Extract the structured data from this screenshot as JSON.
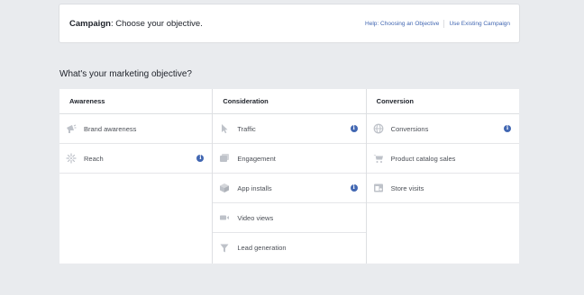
{
  "header": {
    "title_bold": "Campaign",
    "title_rest": ": Choose your objective.",
    "help_link": "Help: Choosing an Objective",
    "existing_link": "Use Existing Campaign"
  },
  "section_title": "What's your marketing objective?",
  "columns": [
    {
      "heading": "Awareness",
      "items": [
        {
          "label": "Brand awareness",
          "icon": "megaphone-icon",
          "info": false
        },
        {
          "label": "Reach",
          "icon": "reach-burst-icon",
          "info": true
        }
      ]
    },
    {
      "heading": "Consideration",
      "items": [
        {
          "label": "Traffic",
          "icon": "cursor-icon",
          "info": true
        },
        {
          "label": "Engagement",
          "icon": "engagement-icon",
          "info": false
        },
        {
          "label": "App installs",
          "icon": "box-icon",
          "info": true
        },
        {
          "label": "Video views",
          "icon": "video-camera-icon",
          "info": false
        },
        {
          "label": "Lead generation",
          "icon": "funnel-icon",
          "info": false
        }
      ]
    },
    {
      "heading": "Conversion",
      "items": [
        {
          "label": "Conversions",
          "icon": "globe-icon",
          "info": true
        },
        {
          "label": "Product catalog sales",
          "icon": "cart-icon",
          "info": false
        },
        {
          "label": "Store visits",
          "icon": "store-icon",
          "info": false
        }
      ]
    }
  ],
  "colors": {
    "background": "#e9ebee",
    "link": "#4267b2",
    "icon_gray": "#bec2c9",
    "info_badge": "#4267b2"
  }
}
